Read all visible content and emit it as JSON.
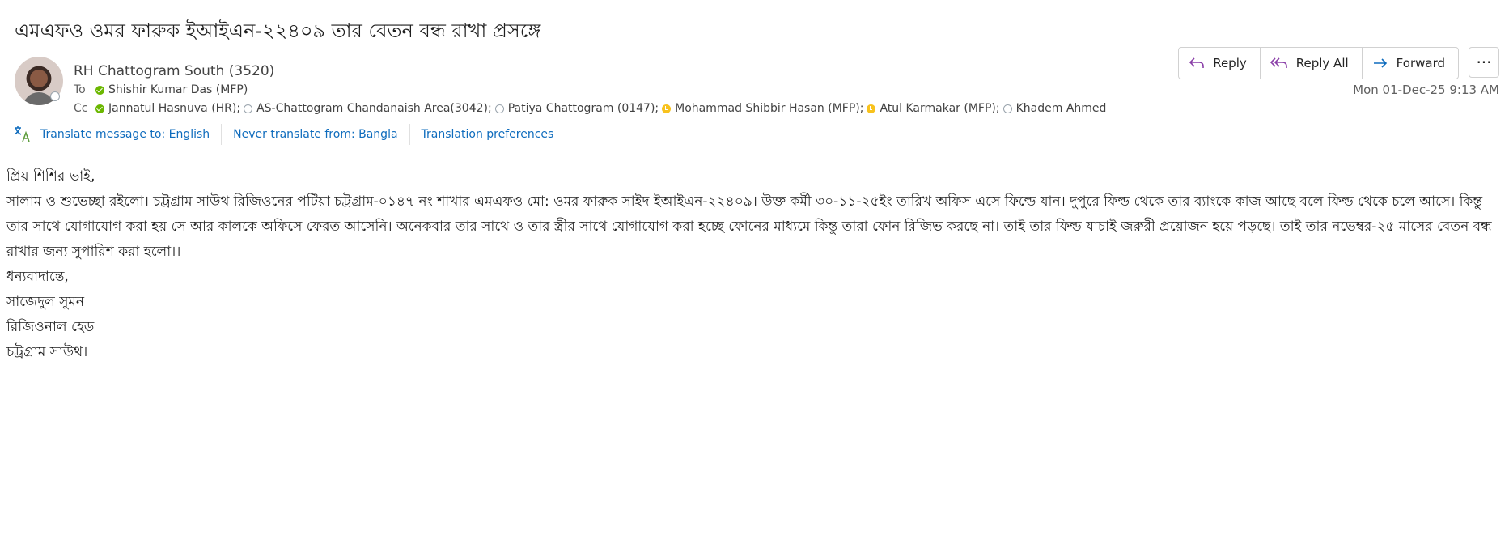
{
  "subject": "এমএফও ওমর ফারুক ইআইএন-২২৪০৯ তার বেতন বন্ধ রাখা প্রসঙ্গে",
  "sender": "RH Chattogram South (3520)",
  "to_label": "To",
  "cc_label": "Cc",
  "to": [
    {
      "name": "Shishir Kumar Das (MFP)",
      "status": "available"
    }
  ],
  "cc": [
    {
      "name": "Jannatul Hasnuva (HR);",
      "status": "available"
    },
    {
      "name": "AS-Chattogram Chandanaish Area(3042);",
      "status": "offline"
    },
    {
      "name": "Patiya Chattogram (0147);",
      "status": "offline"
    },
    {
      "name": "Mohammad Shibbir Hasan (MFP);",
      "status": "away"
    },
    {
      "name": "Atul  Karmakar (MFP);",
      "status": "away"
    },
    {
      "name": "Khadem Ahmed",
      "status": "offline"
    }
  ],
  "actions": {
    "reply": "Reply",
    "reply_all": "Reply All",
    "forward": "Forward",
    "more": "···"
  },
  "date": "Mon 01-Dec-25 9:13 AM",
  "translation": {
    "translate_to": "Translate message to: English",
    "never_translate": "Never translate from: Bangla",
    "preferences": "Translation preferences"
  },
  "body": {
    "greeting": "প্রিয় শিশির ভাই,",
    "paragraph": "সালাম ও শুভেচ্ছা রইলো। চট্রগ্রাম সাউথ রিজিওনের পটিয়া চট্রগ্রাম-০১৪৭ নং শাখার এমএফও মো: ওমর ফারুক সাইদ ইআইএন-২২৪০৯। উক্ত কর্মী ৩০-১১-২৫ইং তারিখ অফিস এসে ফিল্ডে যান।  দুপুরে ফিল্ড থেকে তার ব্যাংকে কাজ আছে বলে ফিল্ড থেকে চলে আসে।  কিন্তু তার সাথে যোগাযোগ করা হয় সে আর কালকে অফিসে ফেরত আসেনি। অনেকবার তার সাথে ও তার স্ত্রীর সাথে যোগাযোগ করা হচ্ছে ফোনের মাধ্যমে কিন্তু  তারা ফোন রিজিভ করছে না। তাই তার ফিল্ড যাচাই জরুরী প্রয়োজন হয়ে পড়ছে। তাই তার নভেম্বর-২৫ মাসের বেতন বন্ধ রাখার জন্য সুপারিশ করা হলো।।",
    "closing": "ধন্যবাদান্তে,",
    "signature_name": "সাজেদুল সুমন",
    "signature_title": "রিজিওনাল হেড",
    "signature_region": "চট্রগ্রাম সাউথ।"
  }
}
